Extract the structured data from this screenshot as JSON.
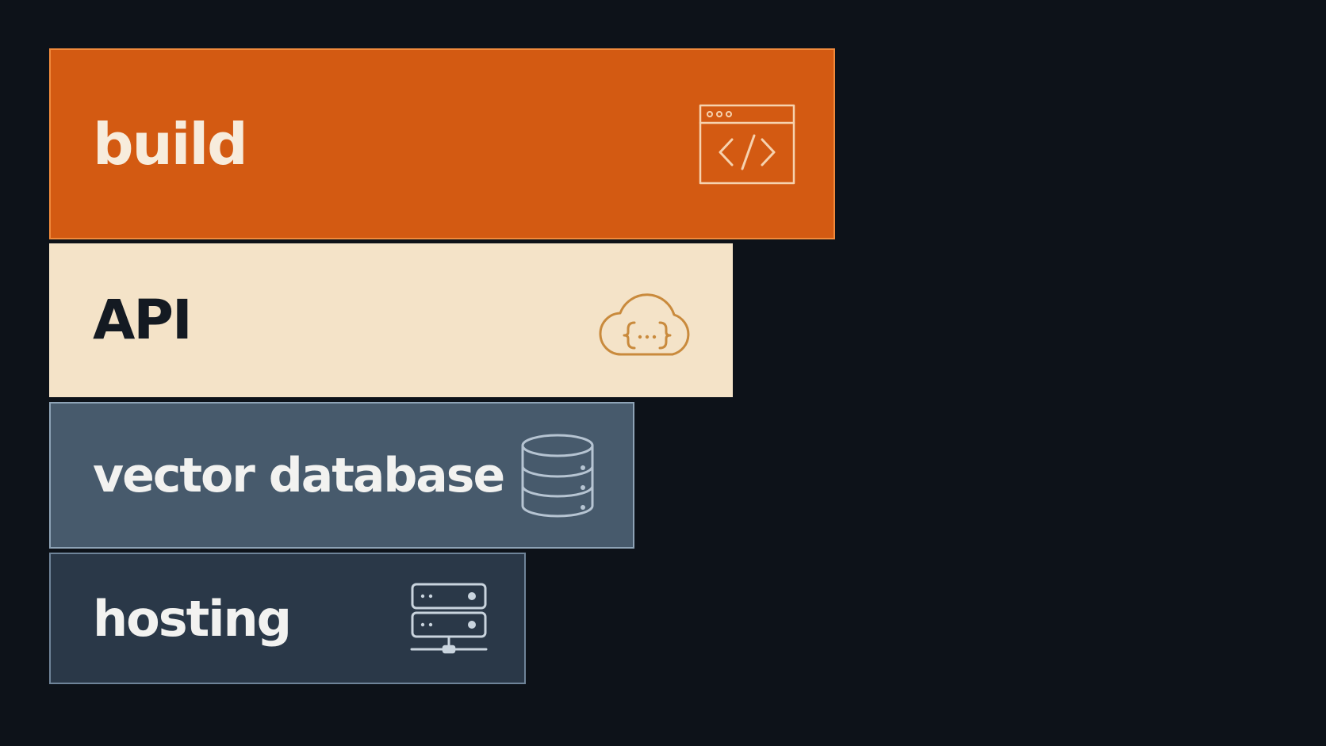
{
  "layers": [
    {
      "label": "build",
      "icon": "code-window-icon",
      "fill": "#d35a12",
      "border": "#f08a3c",
      "text_color": "#f7ecdc",
      "icon_color": "#f6d2ae"
    },
    {
      "label": "API",
      "icon": "cloud-braces-icon",
      "fill": "#f4e3c8",
      "border": "#f4e3c8",
      "text_color": "#141a22",
      "icon_color": "#c98a3c"
    },
    {
      "label": "vector database",
      "icon": "database-icon",
      "fill": "#475a6c",
      "border": "#8ea3b6",
      "text_color": "#f2f2f0",
      "icon_color": "#b6c4d2"
    },
    {
      "label": "hosting",
      "icon": "server-network-icon",
      "fill": "#2a3848",
      "border": "#6f8499",
      "text_color": "#f2f2f0",
      "icon_color": "#c9d4de"
    }
  ]
}
